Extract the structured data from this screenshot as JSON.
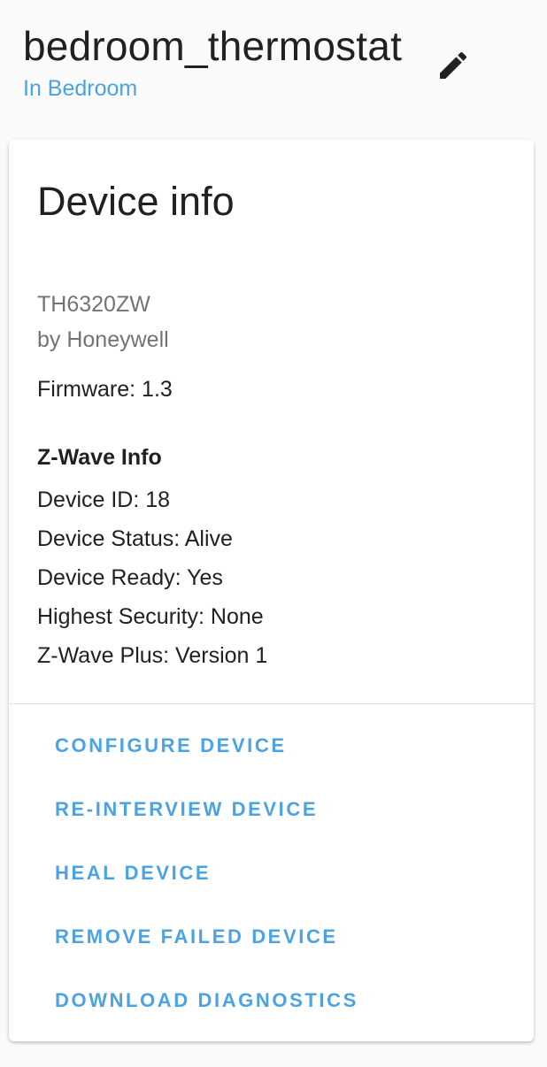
{
  "header": {
    "device_name": "bedroom_thermostat",
    "area_label": "In Bedroom",
    "edit_icon": "pencil-icon"
  },
  "device_info": {
    "title": "Device info",
    "model": "TH6320ZW",
    "manufacturer": "by Honeywell",
    "firmware": "Firmware: 1.3",
    "zwave": {
      "heading": "Z-Wave Info",
      "lines": [
        "Device ID: 18",
        "Device Status: Alive",
        "Device Ready: Yes",
        "Highest Security: None",
        "Z-Wave Plus: Version 1"
      ]
    },
    "actions": [
      "CONFIGURE DEVICE",
      "RE-INTERVIEW DEVICE",
      "HEAL DEVICE",
      "REMOVE FAILED DEVICE",
      "DOWNLOAD DIAGNOSTICS"
    ]
  },
  "colors": {
    "accent": "#4ba3e3",
    "text_primary": "#212121",
    "text_secondary": "#737373",
    "background": "#fafafa"
  }
}
